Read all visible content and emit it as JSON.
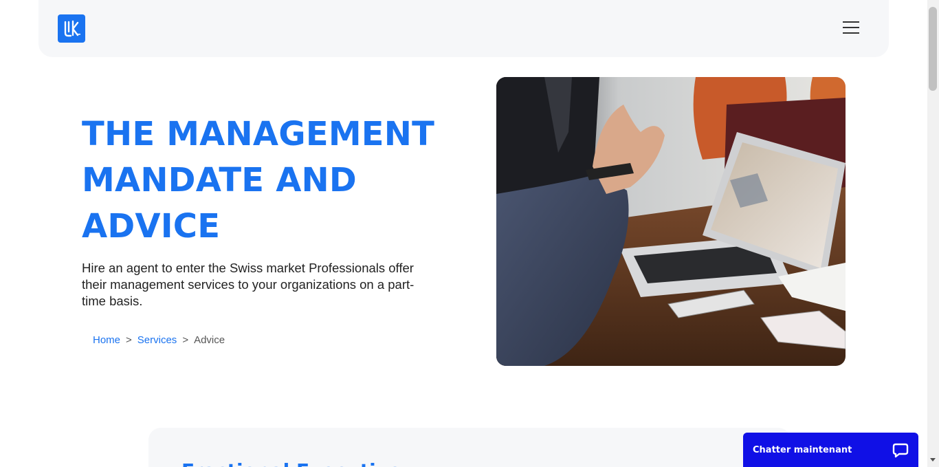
{
  "header": {
    "logo_text": "LK",
    "menu_icon": "hamburger-menu-icon"
  },
  "hero": {
    "title": "THE MANAGEMENT MANDATE AND ADVICE",
    "description": "Hire an agent to enter the Swiss market Professionals offer their management services to your organizations on a part-time basis."
  },
  "breadcrumb": {
    "home": "Home",
    "services": "Services",
    "current": "Advice",
    "separator": ">"
  },
  "section": {
    "heading": "Fractional Executive"
  },
  "chat": {
    "label": "Chatter maintenant",
    "icon": "chat-bubble-icon"
  },
  "colors": {
    "accent": "#1a73f0",
    "chat_bg": "#1010e6",
    "header_bg": "#f6f7f9"
  }
}
